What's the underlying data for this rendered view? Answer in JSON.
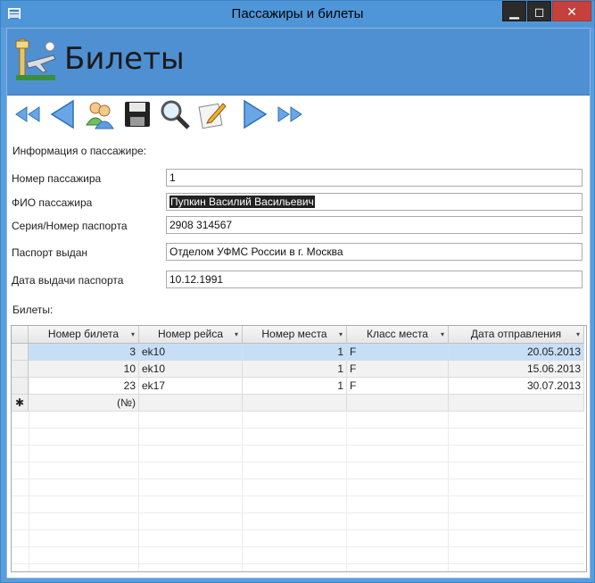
{
  "window": {
    "title": "Пассажиры и билеты",
    "min": "▁",
    "max": "◻",
    "close": "✕"
  },
  "header": {
    "title": "Билеты"
  },
  "toolbar": {
    "icons": [
      "first-record-icon",
      "previous-record-icon",
      "passengers-icon",
      "save-icon",
      "search-icon",
      "edit-icon",
      "next-record-icon",
      "last-record-icon"
    ]
  },
  "passenger": {
    "section_label": "Информация о пассажире:",
    "fields": [
      {
        "label": "Номер пассажира",
        "value": "1"
      },
      {
        "label": "ФИО пассажира",
        "value": "Пупкин Василий Васильевич"
      },
      {
        "label": "Серия/Номер паспорта",
        "value": "2908 314567"
      },
      {
        "label": "Паспорт выдан",
        "value": "Отделом УФМС России в г. Москва"
      },
      {
        "label": "Дата выдачи паспорта",
        "value": "10.12.1991"
      }
    ]
  },
  "tickets": {
    "section_label": "Билеты:",
    "columns": [
      "Номер билета",
      "Номер рейса",
      "Номер места",
      "Класс места",
      "Дата отправления"
    ],
    "dropdown_glyph": "▾",
    "rows": [
      {
        "ticket": "3",
        "flight": "ek10",
        "seat": "1",
        "class": "F",
        "date": "20.05.2013"
      },
      {
        "ticket": "10",
        "flight": "ek10",
        "seat": "1",
        "class": "F",
        "date": "15.06.2013"
      },
      {
        "ticket": "23",
        "flight": "ek17",
        "seat": "1",
        "class": "F",
        "date": "30.07.2013"
      }
    ],
    "new_row_marker": "✱",
    "new_row_placeholder": "(№)"
  },
  "colors": {
    "titlebar": "#4f96d9",
    "header": "#4f90d3",
    "close": "#c7413c",
    "selected_row": "#c6dff7"
  }
}
